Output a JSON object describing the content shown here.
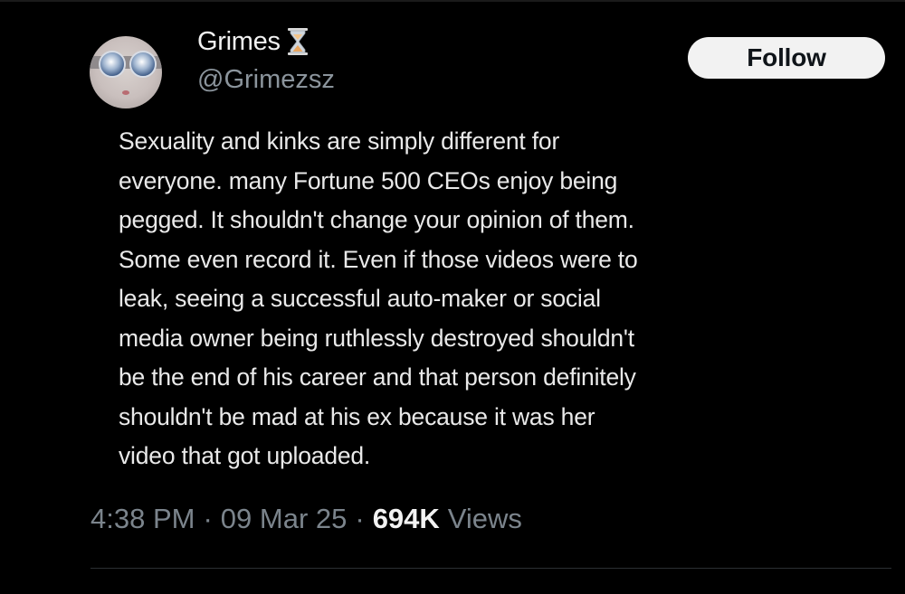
{
  "user": {
    "display_name": "Grimes",
    "handle": "@Grimezsz",
    "badge_icon": "hourglass-icon",
    "avatar_icon": "avatar-goggles-icon"
  },
  "actions": {
    "follow_label": "Follow"
  },
  "tweet": {
    "lines": [
      "Sexuality and kinks are simply different for",
      "everyone. many Fortune 500 CEOs enjoy being",
      "pegged. It shouldn't change your opinion of them.",
      "Some even record it. Even if those videos were to",
      "leak, seeing a successful auto-maker or social",
      "media owner being ruthlessly destroyed shouldn't",
      "be the end of his career and that person definitely",
      "shouldn't be mad at his ex because it was her",
      "video that got uploaded."
    ]
  },
  "meta": {
    "time": "4:38 PM",
    "separator": "·",
    "date": "09 Mar 25",
    "views_count": "694K",
    "views_label": "Views"
  },
  "colors": {
    "background": "#000000",
    "text_primary": "#e9e9e9",
    "text_secondary": "#7b848c",
    "follow_button_bg": "#f2f2f2",
    "follow_button_text": "#0f1419"
  }
}
